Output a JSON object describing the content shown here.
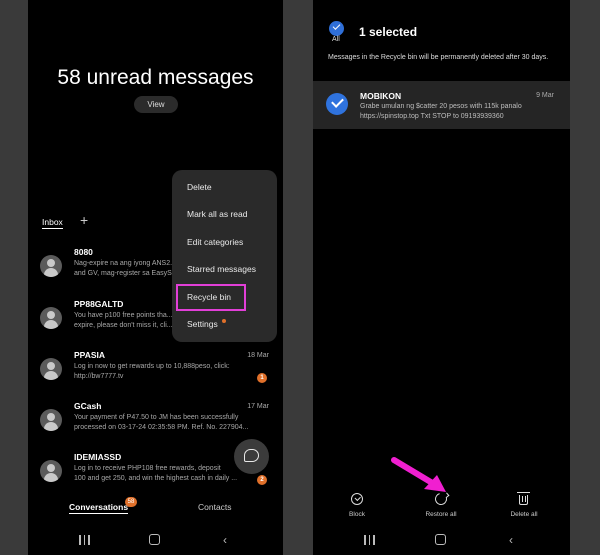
{
  "left": {
    "unread_title": "58 unread messages",
    "view_label": "View",
    "inbox_tab": "Inbox",
    "add_tab_icon": "plus-icon",
    "conversations": [
      {
        "name": "8080",
        "date": "",
        "snippet_line1": "Nag-expire na ang iyong ANS2...",
        "snippet_line2": "and GV, mag-register sa EasyS...",
        "badge": ""
      },
      {
        "name": "PP88GALTD",
        "date": "",
        "snippet_line1": "You have p100 free points tha...",
        "snippet_line2": "expire, please don't miss it, cli...",
        "badge": ""
      },
      {
        "name": "PPASIA",
        "date": "18 Mar",
        "snippet_line1": "Log in now to get rewards up to 10,888peso, click:",
        "snippet_line2": "http://bw7777.tv",
        "badge": "1"
      },
      {
        "name": "GCash",
        "date": "17 Mar",
        "snippet_line1": "Your payment of P47.50 to JM has been successfully",
        "snippet_line2": "processed on 03-17-24 02:35:58 PM. Ref. No. 227904...",
        "badge": ""
      },
      {
        "name": "IDEMIASSD",
        "date": "",
        "snippet_line1": "Log in to receive PHP108 free rewards, deposit",
        "snippet_line2": "100 and get 250, and win the highest cash in daily ...",
        "badge": "2"
      }
    ],
    "menu": {
      "items": [
        "Delete",
        "Mark all as read",
        "Edit categories",
        "Starred messages",
        "Recycle bin",
        "Settings"
      ],
      "highlight_color": "#e23fd8"
    },
    "fab_icon": "new-chat-icon",
    "bottom_tabs": {
      "conversations": "Conversations",
      "conversations_badge": "58",
      "contacts": "Contacts"
    }
  },
  "right": {
    "all_label": "All",
    "selected_title": "1 selected",
    "notice": "Messages in the Recycle bin will be permanently deleted after 30 days.",
    "message": {
      "name": "MOBIKON",
      "date": "9 Mar",
      "snippet_line1": "Grabe umulan ng $catter 20 pesos with 115k panalo",
      "snippet_line2": "https://spinstop.top Txt STOP to 09193939360"
    },
    "actions": [
      "Block",
      "Restore all",
      "Delete all"
    ],
    "arrow_color": "#f01fd0"
  },
  "colors": {
    "accent_blue": "#2f73de",
    "badge_orange": "#e0702a",
    "background": "#000000"
  }
}
